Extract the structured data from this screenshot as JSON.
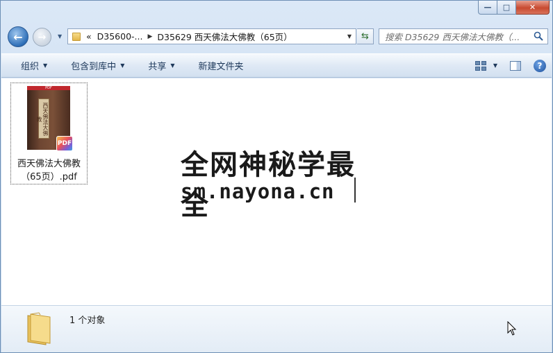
{
  "window": {
    "min_label": "—",
    "max_label": "□",
    "close_label": "✕"
  },
  "nav": {
    "history_arrow": "▼",
    "address_chevron": "«",
    "address_parts": [
      "D35600-...",
      "D35629 西天佛法大佛教（65页）"
    ],
    "search_placeholder": "搜索 D35629 西天佛法大佛教（..."
  },
  "toolbar": {
    "items": [
      {
        "label": "组织",
        "has_menu": true
      },
      {
        "label": "包含到库中",
        "has_menu": true
      },
      {
        "label": "共享",
        "has_menu": true
      },
      {
        "label": "新建文件夹",
        "has_menu": false
      }
    ],
    "help_label": "?"
  },
  "file": {
    "name_line1": "西天佛法大佛教",
    "name_line2": "（65页）.pdf",
    "thumb_top": "PDF",
    "thumb_title": "西天佛法大佛教",
    "badge": "PDF"
  },
  "watermark": {
    "line1": "全网神秘学最全",
    "line2": "sm.nayona.cn"
  },
  "status": {
    "count_text": "1 个对象"
  }
}
